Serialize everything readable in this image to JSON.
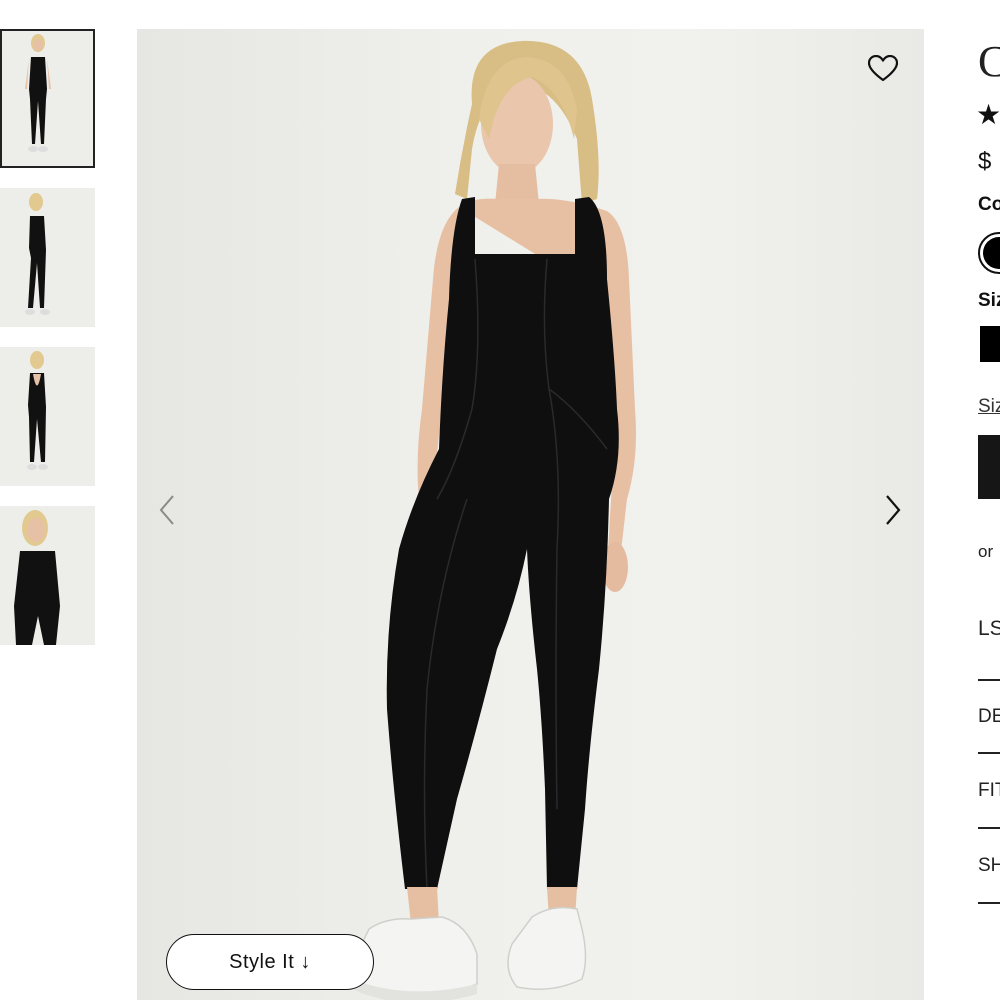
{
  "gallery": {
    "thumbnails": [
      {
        "view": "front",
        "active": true
      },
      {
        "view": "side",
        "active": false
      },
      {
        "view": "back",
        "active": false
      },
      {
        "view": "closeup",
        "active": false
      }
    ],
    "style_it_label": "Style It ↓",
    "icons": {
      "wishlist": "heart-icon",
      "prev": "chevron-left-icon",
      "next": "chevron-right-icon"
    }
  },
  "product": {
    "title_visible": "C",
    "rating_star": "★",
    "price_visible": "$",
    "color_label": "Co",
    "size_label": "Siz",
    "size_guide_label": "Siz",
    "or_text": "or",
    "accordion": [
      "LS",
      "DE",
      "FIT",
      "SH"
    ]
  },
  "colors": {
    "garment": "#0f0f10",
    "background": "#ecece8",
    "accent": "#111111"
  }
}
